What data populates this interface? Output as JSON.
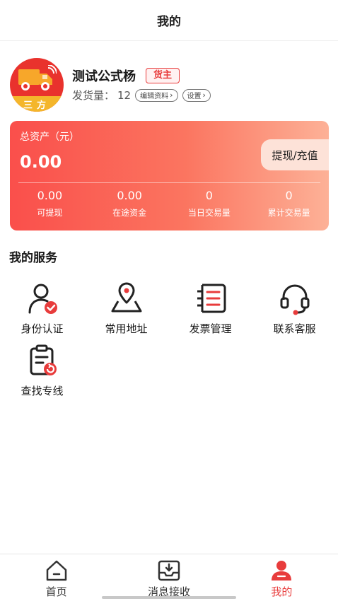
{
  "header": {
    "title": "我的"
  },
  "profile": {
    "avatar_text": "三方",
    "name": "测试公式杨",
    "role": "货主",
    "ship_label": "发货量：",
    "ship_count": "12",
    "edit_label": "编辑资料",
    "settings_label": "设置"
  },
  "assets": {
    "label": "总资产（元）",
    "total": "0.00",
    "action_label": "提现/充值",
    "stats": [
      {
        "value": "0.00",
        "label": "可提现"
      },
      {
        "value": "0.00",
        "label": "在途资金"
      },
      {
        "value": "0",
        "label": "当日交易量"
      },
      {
        "value": "0",
        "label": "累计交易量"
      }
    ]
  },
  "services": {
    "title": "我的服务",
    "items": [
      {
        "label": "身份认证",
        "icon": "identity-verify-icon"
      },
      {
        "label": "常用地址",
        "icon": "map-location-icon"
      },
      {
        "label": "发票管理",
        "icon": "invoice-list-icon"
      },
      {
        "label": "联系客服",
        "icon": "headset-icon"
      },
      {
        "label": "查找专线",
        "icon": "search-route-icon"
      }
    ]
  },
  "tabbar": {
    "items": [
      {
        "label": "首页",
        "icon": "home-icon",
        "active": false
      },
      {
        "label": "消息接收",
        "icon": "inbox-icon",
        "active": false
      },
      {
        "label": "我的",
        "icon": "user-icon",
        "active": true
      }
    ]
  },
  "colors": {
    "accent": "#e83c3c",
    "card_start": "#fa4f4b",
    "card_end": "#fdb197",
    "avatar_yellow": "#f4b62b"
  }
}
